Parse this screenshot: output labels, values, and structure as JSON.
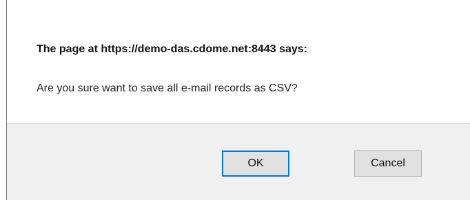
{
  "dialog": {
    "title": "The page at https://demo-das.cdome.net:8443 says:",
    "message": "Are you sure want to save all e-mail records as CSV?",
    "buttons": {
      "ok_label": "OK",
      "cancel_label": "Cancel"
    },
    "colors": {
      "footer_background": "#f0f0f0",
      "button_background": "#e1e1e1",
      "focus_border": "#0078d7"
    }
  }
}
